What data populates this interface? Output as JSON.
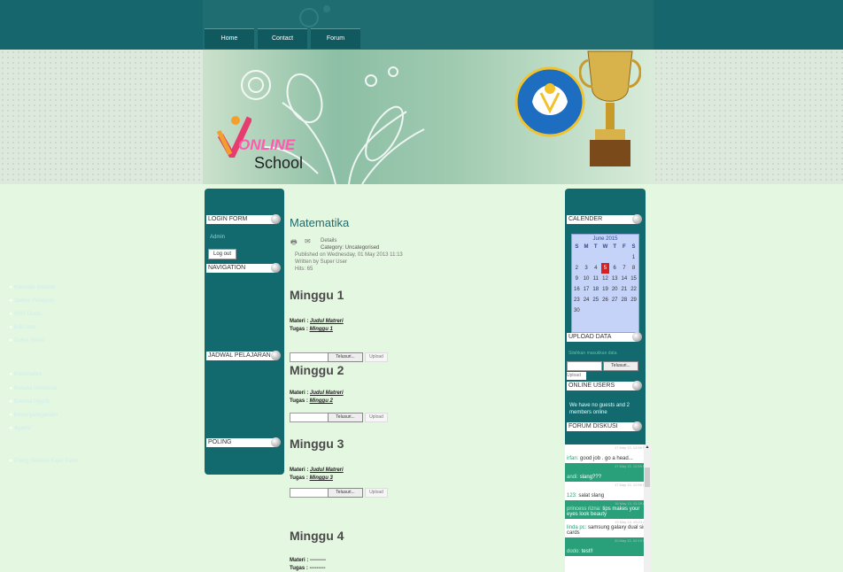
{
  "nav": {
    "tabs": [
      "Home",
      "Contact",
      "Forum"
    ]
  },
  "logo": {
    "word1": "ONLINE",
    "word2": "School"
  },
  "left_sidebar": {
    "login": {
      "header": "LOGIN FORM",
      "greeting": "Admin",
      "logout_label": "Log out"
    },
    "navigation": {
      "header": "NAVIGATION",
      "items": [
        "Kalendar Sekolah",
        "Jadwal Pelajaran",
        "SMS Gratis",
        "Edit User",
        "Daftar Siswa"
      ]
    },
    "jadwal": {
      "header": "JADWAL PELAJARAN",
      "items": [
        "Matematika",
        "Bahasa Indonesia",
        "Bahasa Inggris",
        "Kewarganegaraan",
        "Agama"
      ]
    },
    "poling": {
      "header": "POLING",
      "items": [
        "Poling Sekolah Kajar Paket"
      ]
    }
  },
  "article": {
    "title": "Matematika",
    "details_label": "Details",
    "category": "Category: Uncategorised",
    "published": "Published on Wednesday, 01 May 2013 11:13",
    "written_by": "Written by Super User",
    "hits": "Hits: 65",
    "weeks": [
      {
        "heading": "Minggu 1",
        "materi_label": "Materi :",
        "materi_value": "Judul Matreri",
        "tugas_label": "Tugas :",
        "tugas_value": "Minggu 1"
      },
      {
        "heading": "Minggu 2",
        "materi_label": "Materi :",
        "materi_value": "Judul Matreri",
        "tugas_label": "Tugas :",
        "tugas_value": "Minggu 2"
      },
      {
        "heading": "Minggu 3",
        "materi_label": "Materi :",
        "materi_value": "Judul Matreri",
        "tugas_label": "Tugas :",
        "tugas_value": "Minggu 3"
      },
      {
        "heading": "Minggu 4",
        "materi_label": "Materi :",
        "materi_value": "---------",
        "tugas_label": "Tugas :",
        "tugas_value": "---------"
      }
    ],
    "browse_label": "Telusuri...",
    "upload_label": "Upload"
  },
  "right_sidebar": {
    "calendar": {
      "header": "CALENDER",
      "month": "June 2015",
      "weekdays": [
        "S",
        "M",
        "T",
        "W",
        "T",
        "F",
        "S"
      ],
      "weeks": [
        [
          "",
          "",
          "",
          "",
          "",
          "",
          "1"
        ],
        [
          "2",
          "3",
          "4",
          "5",
          "6",
          "7",
          "8"
        ],
        [
          "9",
          "10",
          "11",
          "12",
          "13",
          "14",
          "15"
        ],
        [
          "16",
          "17",
          "18",
          "19",
          "20",
          "21",
          "22"
        ],
        [
          "23",
          "24",
          "25",
          "26",
          "27",
          "28",
          "29"
        ],
        [
          "30",
          "",
          "",
          "",
          "",
          "",
          ""
        ]
      ],
      "today": "5"
    },
    "upload_data": {
      "header": "UPLOAD DATA",
      "hint": "Silahkan masukkan data",
      "browse_label": "Telusuri...",
      "upload_label": "Upload"
    },
    "online_users": {
      "header": "ONLINE USERS",
      "text": "We have no guests and 2 members online"
    },
    "forum": {
      "header": "FORUM DISKUSI",
      "messages": [
        {
          "name": "irfan:",
          "text": "good job . go a head...",
          "time": "17 May 13, 12:59 PM",
          "style": "light"
        },
        {
          "name": "andi:",
          "text": "slang???",
          "time": "17 May 13, 12:59 PM",
          "style": "dark"
        },
        {
          "name": "123:",
          "text": "salat slang",
          "time": "17 May 13, 12:59 PM",
          "style": "light"
        },
        {
          "name": "princess rizna:",
          "text": "tips makes your eyes look beauty",
          "time": "18 May 13, 01:29 AM",
          "style": "dark"
        },
        {
          "name": "linda pc:",
          "text": "samsung galaxy dual sim cards",
          "time": "19 May 13, 09:23 AM",
          "style": "light"
        },
        {
          "name": "dodo:",
          "text": "test!!",
          "time": "20 May 13, 02:19 PM",
          "style": "dark"
        }
      ]
    }
  }
}
